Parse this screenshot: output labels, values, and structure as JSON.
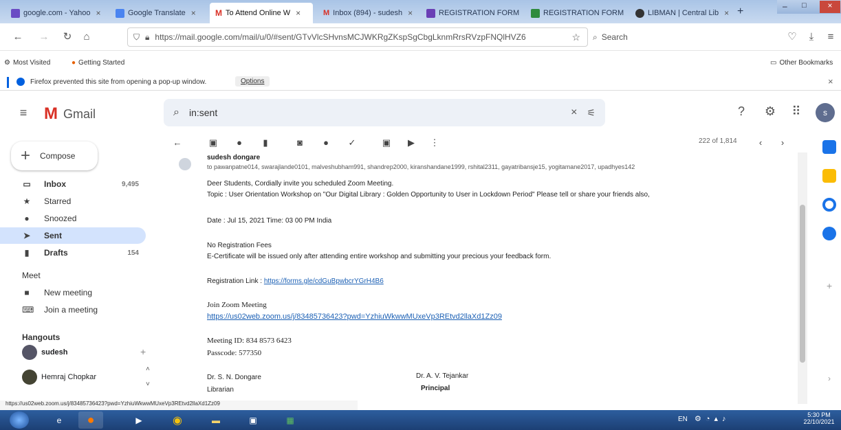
{
  "browser": {
    "tabs": [
      {
        "label": "google.com - Yahoo",
        "color": "#6a4bc4"
      },
      {
        "label": "Google Translate",
        "color": "#4a84f0"
      },
      {
        "label": "To Attend Online W",
        "color": "#d93025",
        "active": true
      },
      {
        "label": "Inbox (894) - sudesh",
        "color": "#d93025"
      },
      {
        "label": "REGISTRATION FORM",
        "color": "#6a3fb5"
      },
      {
        "label": "REGISTRATION FORM",
        "color": "#2e8b3d"
      },
      {
        "label": "LIBMAN | Central Lib",
        "color": "#333333"
      }
    ],
    "new_tab": "+",
    "url": "https://mail.google.com/mail/u/0/#sent/GTvVlcSHvnsMCJWKRgZKspSgCbgLknmRrsRVzpFNQlHVZ6",
    "search_placeholder": "Search",
    "bookmarks": [
      "Most Visited",
      "Getting Started"
    ],
    "other_bookmarks": "Other Bookmarks",
    "popup_message": "Firefox prevented this site from opening a pop-up window.",
    "popup_options": "Options"
  },
  "gmail": {
    "logo_text": "Gmail",
    "search_value": "in:sent",
    "avatar_letter": "s",
    "compose": "Compose",
    "nav": [
      {
        "label": "Inbox",
        "icon": "inbox-icon",
        "count": "9,495",
        "bold": true
      },
      {
        "label": "Starred",
        "icon": "star-icon",
        "count": ""
      },
      {
        "label": "Snoozed",
        "icon": "clock-icon",
        "count": ""
      },
      {
        "label": "Sent",
        "icon": "send-icon",
        "count": "",
        "bold": true,
        "selected": true
      },
      {
        "label": "Drafts",
        "icon": "draft-icon",
        "count": "154",
        "bold": true
      }
    ],
    "meet_heading": "Meet",
    "meet_items": [
      "New meeting",
      "Join a meeting"
    ],
    "hangouts_heading": "Hangouts",
    "hangouts_user": "sudesh",
    "hangouts_contact": "Hemraj Chopkar",
    "pager": "222 of 1,814"
  },
  "mail": {
    "sender": "sudesh dongare",
    "to_line": "to pawanpatne014, swarajlande0101, malveshubham991, shandrep2000, kiranshandane1999, rshital2311, gayatribansje15, yogitamane2017, upadhyes142",
    "greeting": "Deer Students, Cordially invite you scheduled Zoom Meeting.",
    "topic": "Topic : User Orientation Workshop on \"Our Digital Library : Golden Opportunity to User in Lockdown Period\" Please tell or share your friends also,",
    "date": "Date : Jul 15, 2021    Time: 03 00 PM India",
    "fees": "No Registration Fees",
    "certificate": "E-Certificate will be issued only after attending entire workshop and submitting your precious your feedback form.",
    "reg_label": "Registration Link : ",
    "reg_link": "https://forms.gle/cdGuBpwbcrYGrH4B6",
    "join_label": "Join Zoom Meeting",
    "join_link": "https://us02web.zoom.us/j/83485736423?pwd=YzhiuWkwwMUxeVp3REtvd2llaXd1Zz09",
    "meeting_id": "Meeting ID: 834 8573 6423",
    "passcode": "Passcode: 577350",
    "sig1_name": "Dr. S. N. Dongare",
    "sig1_role": "Librarian",
    "sig2_name": "Dr. A. V. Tejankar",
    "sig2_role": "Principal"
  },
  "status_url": "https://us02web.zoom.us/j/83485736423?pwd=YzhiuWkwwMUxeVp3REtvd2llaXd1Zz09",
  "taskbar": {
    "time": "5:30 PM",
    "date": "22/10/2021",
    "lang": "EN"
  },
  "colors": {
    "gmail_red": "#d93025",
    "link": "#1a5fb4",
    "selected_nav": "#d3e3fd"
  }
}
